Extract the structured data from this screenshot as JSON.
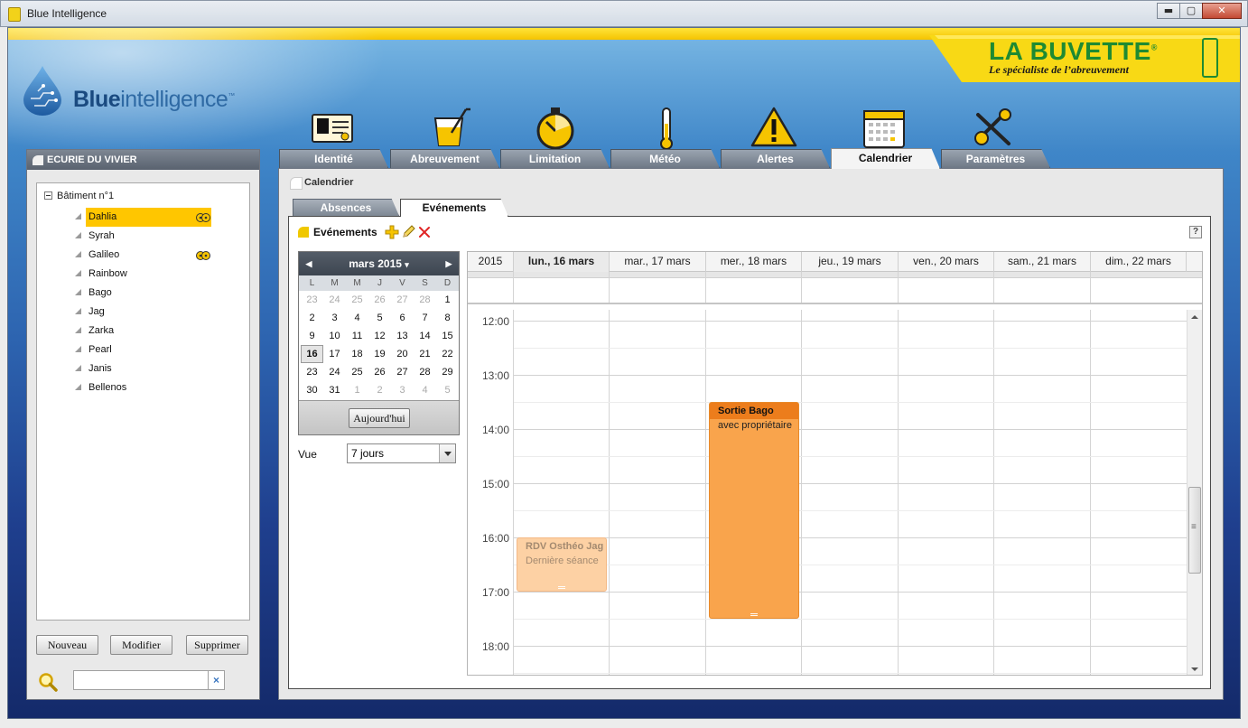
{
  "window": {
    "title": "Blue Intelligence",
    "minimize": "▬",
    "maximize": "▢",
    "close": "✕"
  },
  "logo": {
    "bold": "Blue",
    "regular": "intelligence",
    "tm": "™"
  },
  "partner": {
    "name": "LA BUVETTE",
    "tagline": "Le spécialiste de l’abreuvement",
    "reg": "®"
  },
  "stable": {
    "title": "ECURIE DU VIVIER",
    "building": "Bâtiment n°1",
    "horses": [
      {
        "name": "Dahlia",
        "selected": true,
        "flag": true
      },
      {
        "name": "Syrah",
        "selected": false,
        "flag": false
      },
      {
        "name": "Galileo",
        "selected": false,
        "flag": true
      },
      {
        "name": "Rainbow",
        "selected": false,
        "flag": false
      },
      {
        "name": "Bago",
        "selected": false,
        "flag": false
      },
      {
        "name": "Jag",
        "selected": false,
        "flag": false
      },
      {
        "name": "Zarka",
        "selected": false,
        "flag": false
      },
      {
        "name": "Pearl",
        "selected": false,
        "flag": false
      },
      {
        "name": "Janis",
        "selected": false,
        "flag": false
      },
      {
        "name": "Bellenos",
        "selected": false,
        "flag": false
      }
    ],
    "buttons": {
      "new": "Nouveau",
      "edit": "Modifier",
      "delete": "Supprimer"
    },
    "search": {
      "value": "",
      "clear": "×"
    }
  },
  "tabs": [
    {
      "label": "Identité",
      "icon": "id-card-icon"
    },
    {
      "label": "Abreuvement",
      "icon": "drink-glass-icon"
    },
    {
      "label": "Limitation",
      "icon": "stopwatch-icon"
    },
    {
      "label": "Météo",
      "icon": "thermometer-icon"
    },
    {
      "label": "Alertes",
      "icon": "warning-icon"
    },
    {
      "label": "Calendrier",
      "icon": "calendar-icon",
      "active": true
    },
    {
      "label": "Paramètres",
      "icon": "tools-icon"
    }
  ],
  "page": {
    "breadcrumb": "Calendrier",
    "subtabs": [
      {
        "label": "Absences"
      },
      {
        "label": "Evénements",
        "active": true
      }
    ],
    "toolbar_label": "Evénements",
    "help": "?"
  },
  "mini_calendar": {
    "month": "mars 2015",
    "prev": "◀",
    "next": "▶",
    "dropdown": "▾",
    "weekdays": [
      "L",
      "M",
      "M",
      "J",
      "V",
      "S",
      "D"
    ],
    "weeks": [
      [
        "23",
        "24",
        "25",
        "26",
        "27",
        "28",
        "1"
      ],
      [
        "2",
        "3",
        "4",
        "5",
        "6",
        "7",
        "8"
      ],
      [
        "9",
        "10",
        "11",
        "12",
        "13",
        "14",
        "15"
      ],
      [
        "16",
        "17",
        "18",
        "19",
        "20",
        "21",
        "22"
      ],
      [
        "23",
        "24",
        "25",
        "26",
        "27",
        "28",
        "29"
      ],
      [
        "30",
        "31",
        "1",
        "2",
        "3",
        "4",
        "5"
      ]
    ],
    "today": "16",
    "today_button": "Aujourd'hui"
  },
  "view": {
    "label": "Vue",
    "value": "7 jours"
  },
  "week": {
    "year": "2015",
    "days": [
      "lun., 16 mars",
      "mar., 17 mars",
      "mer., 18 mars",
      "jeu., 19 mars",
      "ven., 20 mars",
      "sam., 21 mars",
      "dim., 22 mars"
    ],
    "today_index": 0,
    "hours": [
      "12:00",
      "13:00",
      "14:00",
      "15:00",
      "16:00",
      "17:00",
      "18:00"
    ],
    "events": [
      {
        "title": "RDV Osthéo Jag",
        "description": "Dernière séance",
        "day_index": 0,
        "start": "16:00",
        "end": "17:00"
      },
      {
        "title": "Sortie Bago",
        "description": "avec propriétaire",
        "day_index": 2,
        "start": "13:30",
        "end": "17:30"
      }
    ]
  },
  "colors": {
    "accent_yellow": "#ffc600",
    "event_orange": "#f9a44c",
    "event_orange_header": "#ec7d1c",
    "event_faded": "#fdd1a4",
    "brand_green": "#1e8a32"
  }
}
